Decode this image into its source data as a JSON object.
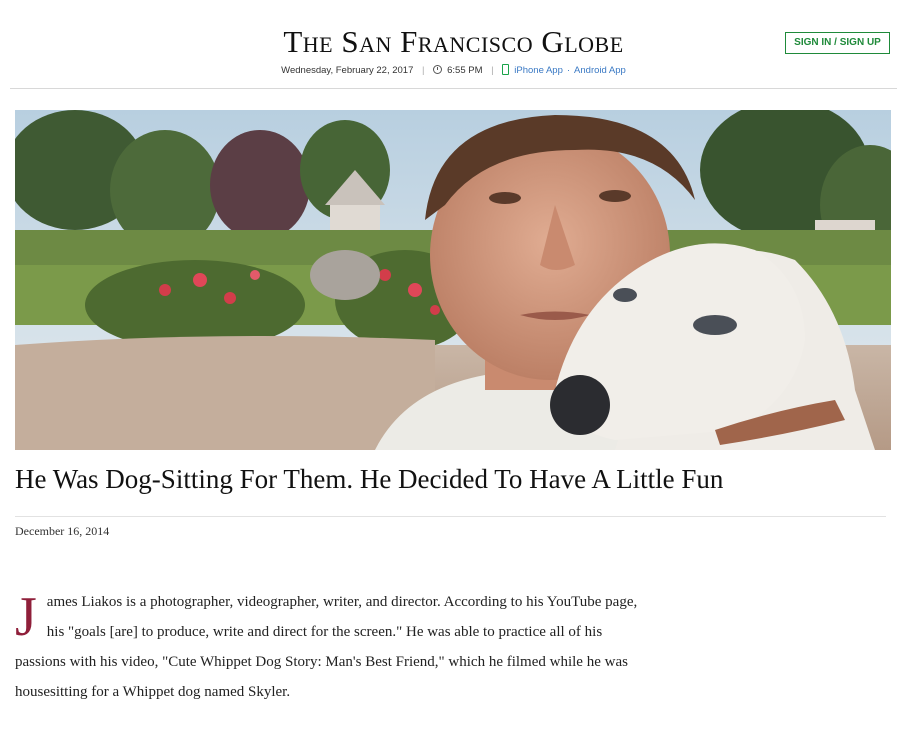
{
  "header": {
    "brand": "The San Francisco Globe",
    "date": "Wednesday, February 22, 2017",
    "time": "6:55 PM",
    "iphone_app": "iPhone App",
    "android_app": "Android App",
    "signin_label": "SIGN IN / SIGN UP",
    "accent_color": "#1f8a3a",
    "link_color": "#3a79c4"
  },
  "article": {
    "headline": "He Was Dog-Sitting For Them. He Decided To Have A Little Fun",
    "date": "December 16, 2014",
    "dropcap": "J",
    "body": "ames Liakos is a photographer, videographer, writer, and director. According to his YouTube page, his \"goals [are] to produce, write and direct for the screen.\" He was able to practice all of his passions with his video, \"Cute Whippet Dog Story: Man's Best Friend,\" which he filmed while he was housesitting for a Whippet dog named Skyler.",
    "dropcap_color": "#8f1f3a"
  },
  "hero": {
    "subject": "man holding whippet dog outdoors"
  }
}
